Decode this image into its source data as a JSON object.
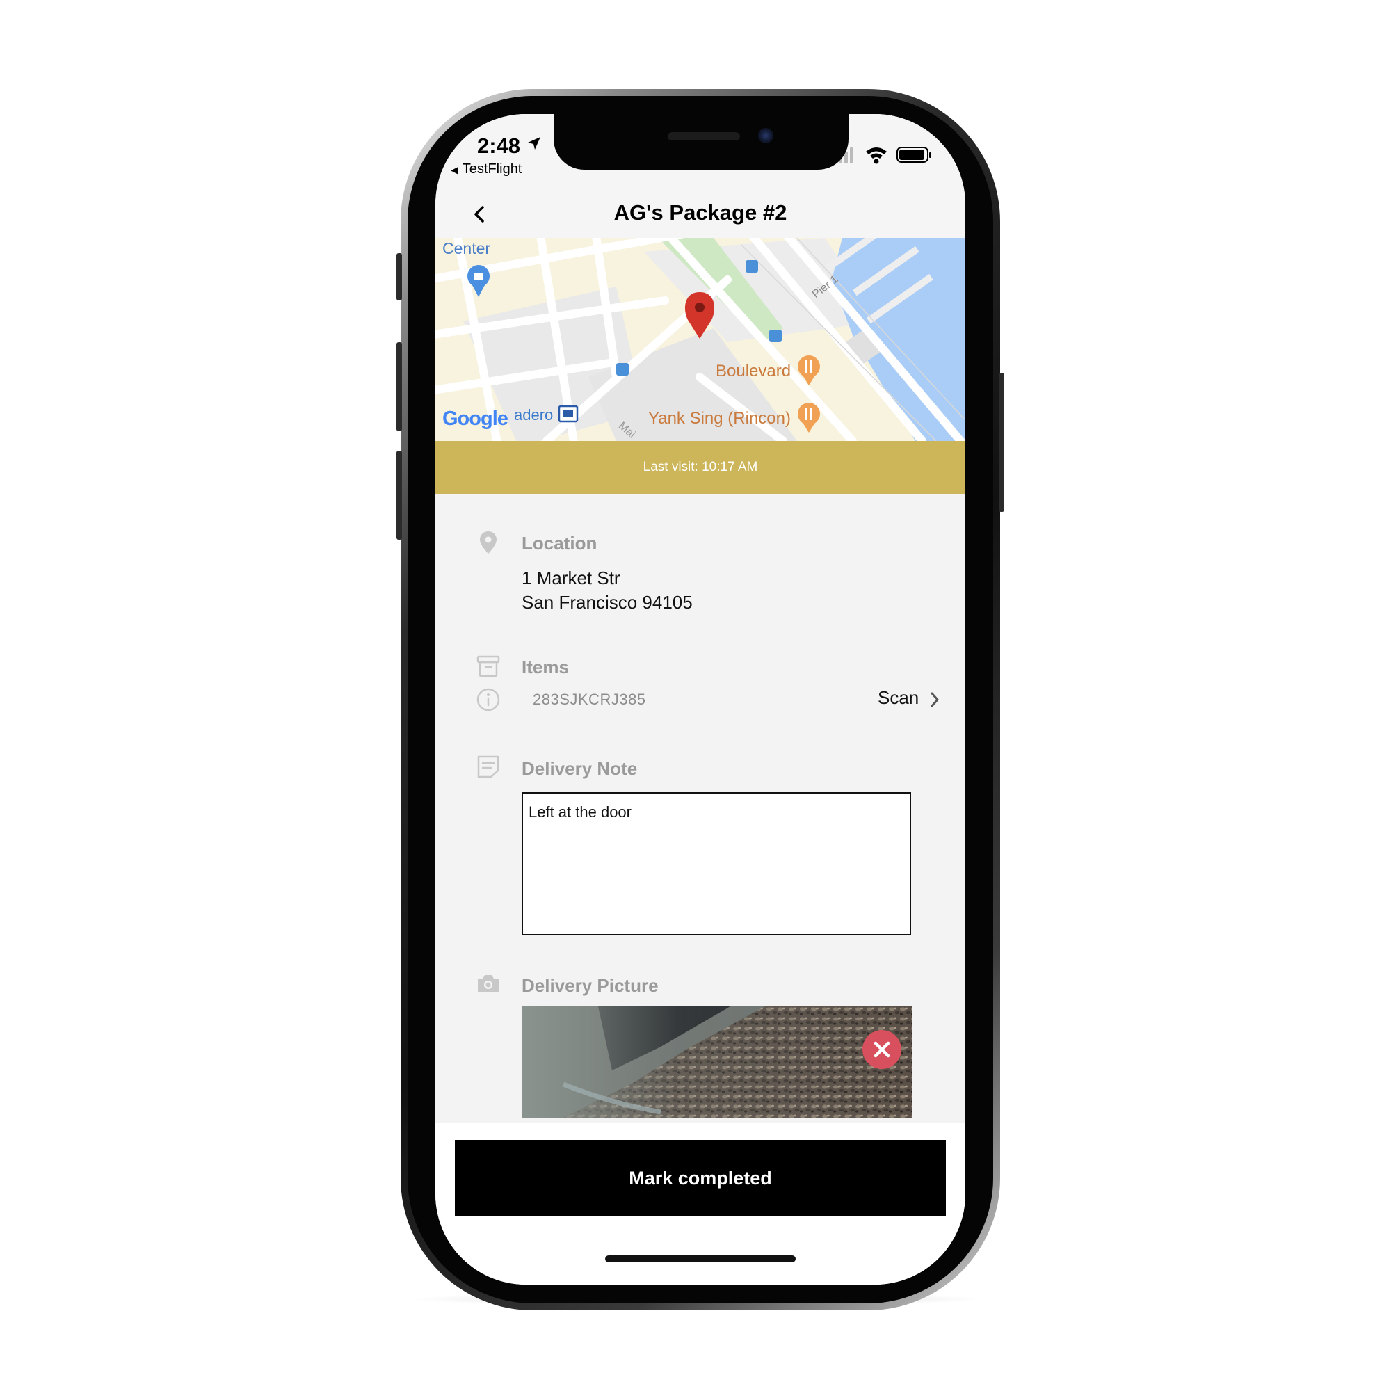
{
  "status_bar": {
    "time": "2:48",
    "back_app": "TestFlight",
    "icons": [
      "location-arrow-icon",
      "cellular-signal-icon",
      "wifi-icon",
      "battery-icon"
    ]
  },
  "nav": {
    "title": "AG's Package #2",
    "back_icon": "chevron-left-icon"
  },
  "map": {
    "labels": {
      "center": "Center",
      "boulevard": "Boulevard",
      "yank_sing": "Yank Sing (Rincon)",
      "pier": "Pier 1",
      "embarcadero": "adero",
      "google": "Google",
      "main_st": "Mai"
    },
    "colors": {
      "water": "#aacdf7",
      "land": "#f8f3df",
      "park": "#cfe8c4",
      "pin": "#d3352a",
      "poi": "#e8894c"
    }
  },
  "banner": {
    "text": "Last visit: 10:17 AM",
    "color": "#ccb659"
  },
  "location": {
    "title": "Location",
    "address_line1": "1 Market Str",
    "address_line2": "San Francisco 94105",
    "icon": "map-pin-icon"
  },
  "items": {
    "title": "Items",
    "icon": "box-icon",
    "rows": [
      {
        "code": "283SJKCRJ385",
        "icon": "info-icon",
        "action": "Scan"
      }
    ]
  },
  "delivery_note": {
    "title": "Delivery Note",
    "icon": "note-icon",
    "value": "Left at the door"
  },
  "delivery_picture": {
    "title": "Delivery Picture",
    "icon": "camera-icon",
    "remove_icon": "close-icon"
  },
  "cta": {
    "label": "Mark completed"
  }
}
